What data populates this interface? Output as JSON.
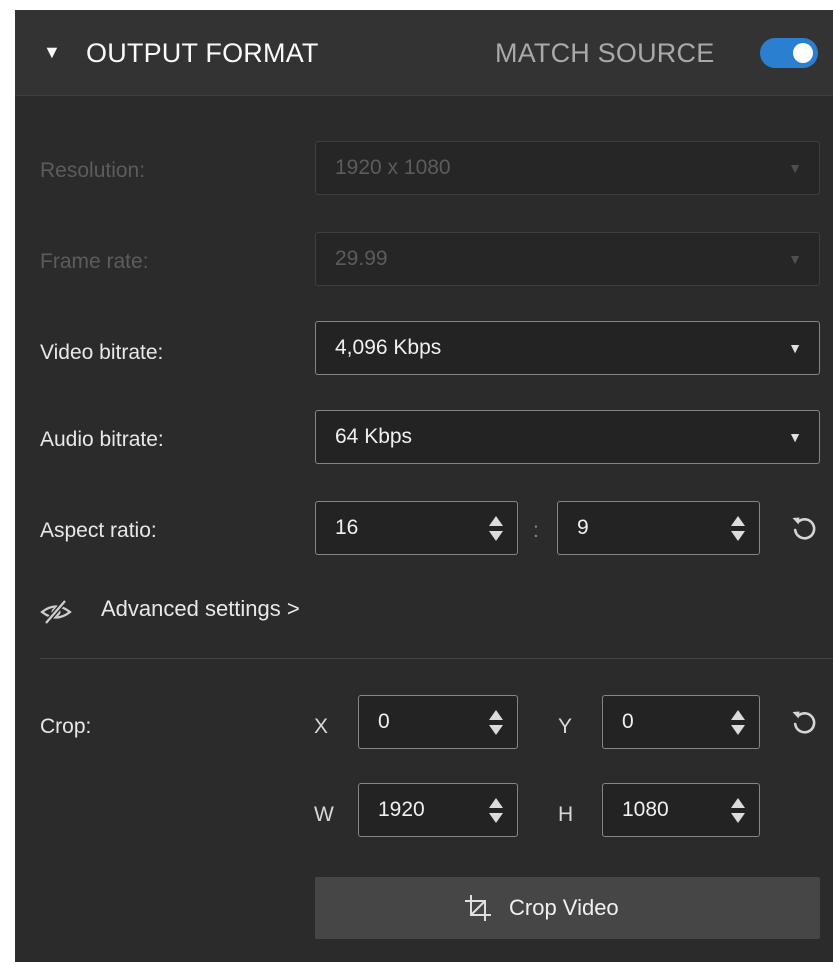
{
  "header": {
    "collapse_glyph": "▼",
    "title": "OUTPUT FORMAT",
    "match_source_label": "MATCH SOURCE",
    "match_source_enabled": true
  },
  "resolution": {
    "label": "Resolution:",
    "value": "1920 x 1080",
    "disabled": true
  },
  "frame_rate": {
    "label": "Frame rate:",
    "value": "29.99",
    "disabled": true
  },
  "video_bitrate": {
    "label": "Video bitrate:",
    "value": "4,096 Kbps"
  },
  "audio_bitrate": {
    "label": "Audio bitrate:",
    "value": "64 Kbps"
  },
  "aspect_ratio": {
    "label": "Aspect ratio:",
    "width": "16",
    "separator": ":",
    "height": "9"
  },
  "advanced": {
    "label": "Advanced settings >"
  },
  "crop": {
    "label": "Crop:",
    "x_label": "X",
    "x_value": "0",
    "y_label": "Y",
    "y_value": "0",
    "w_label": "W",
    "w_value": "1920",
    "h_label": "H",
    "h_value": "1080",
    "button_label": "Crop Video"
  },
  "dropdown_glyph": "▼",
  "colors": {
    "panel_bg": "#2b2b2b",
    "header_bg": "#333333",
    "toggle_accent": "#2a7fd1",
    "field_border": "#858585",
    "button_bg": "#464646"
  },
  "icons": {
    "collapse": "caret-down-icon",
    "dropdown": "dropdown-arrow-icon",
    "spinner": "spinner-arrows-icon",
    "reset": "reset-icon",
    "advanced": "hidden-eye-icon",
    "crop": "crop-icon"
  }
}
